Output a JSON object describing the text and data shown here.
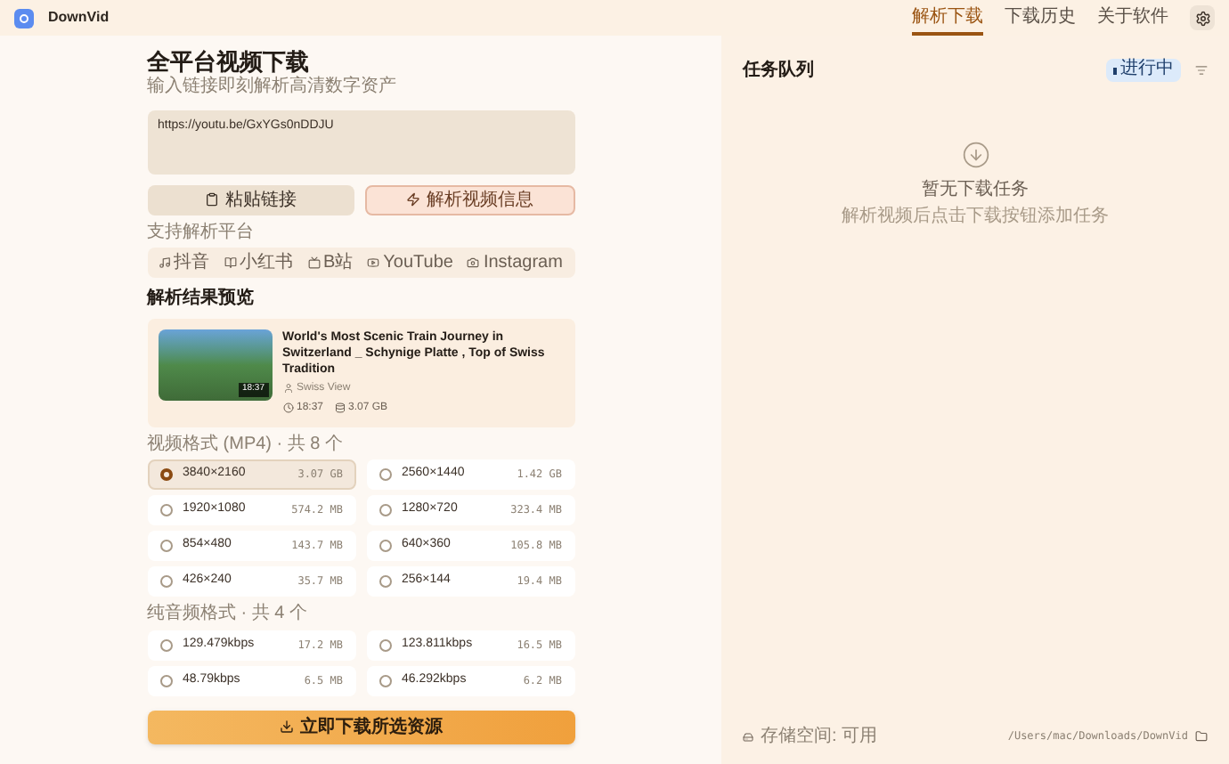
{
  "app": {
    "name": "DownVid"
  },
  "nav": [
    {
      "label": "解析下载",
      "selected": true
    },
    {
      "label": "下载历史",
      "selected": false
    },
    {
      "label": "关于软件",
      "selected": false
    }
  ],
  "main": {
    "title": "全平台视频下载",
    "subtitle": "输入链接即刻解析高清数字资产",
    "url": "https://youtu.be/GxYGs0nDDJU",
    "paste_button": "粘贴链接",
    "parse_button": "解析视频信息",
    "platforms_label": "支持解析平台",
    "platforms": [
      {
        "kind": "music",
        "label": "抖音"
      },
      {
        "kind": "book",
        "label": "小红书"
      },
      {
        "kind": "tv",
        "label": "B站"
      },
      {
        "kind": "play",
        "label": "YouTube"
      },
      {
        "kind": "camera",
        "label": "Instagram"
      }
    ],
    "preview_title": "解析结果预览",
    "video": {
      "title": "World's Most Scenic Train Journey in Switzerland _ Schynige Platte , Top of Swiss Tradition",
      "channel": "Swiss View",
      "thumb_duration": "18:37",
      "duration": "18:37",
      "size": "3.07 GB"
    },
    "video_formats_label": "视频格式 (MP4) · 共 8 个",
    "video_formats": [
      {
        "label": "3840×2160",
        "size": "3.07 GB",
        "selected": true
      },
      {
        "label": "2560×1440",
        "size": "1.42 GB",
        "selected": false
      },
      {
        "label": "1920×1080",
        "size": "574.2 MB",
        "selected": false
      },
      {
        "label": "1280×720",
        "size": "323.4 MB",
        "selected": false
      },
      {
        "label": "854×480",
        "size": "143.7 MB",
        "selected": false
      },
      {
        "label": "640×360",
        "size": "105.8 MB",
        "selected": false
      },
      {
        "label": "426×240",
        "size": "35.7 MB",
        "selected": false
      },
      {
        "label": "256×144",
        "size": "19.4 MB",
        "selected": false
      }
    ],
    "audio_formats_label": "纯音频格式 · 共 4 个",
    "audio_formats": [
      {
        "label": "129.479kbps",
        "size": "17.2 MB",
        "selected": false
      },
      {
        "label": "123.811kbps",
        "size": "16.5 MB",
        "selected": false
      },
      {
        "label": "48.79kbps",
        "size": "6.5 MB",
        "selected": false
      },
      {
        "label": "46.292kbps",
        "size": "6.2 MB",
        "selected": false
      }
    ],
    "download_button": "立即下载所选资源"
  },
  "queue": {
    "title": "任务队列",
    "status": "进行中",
    "empty_title": "暂无下载任务",
    "empty_hint": "解析视频后点击下载按钮添加任务",
    "storage": "存储空间: 可用",
    "path": "/Users/mac/Downloads/DownVid"
  }
}
